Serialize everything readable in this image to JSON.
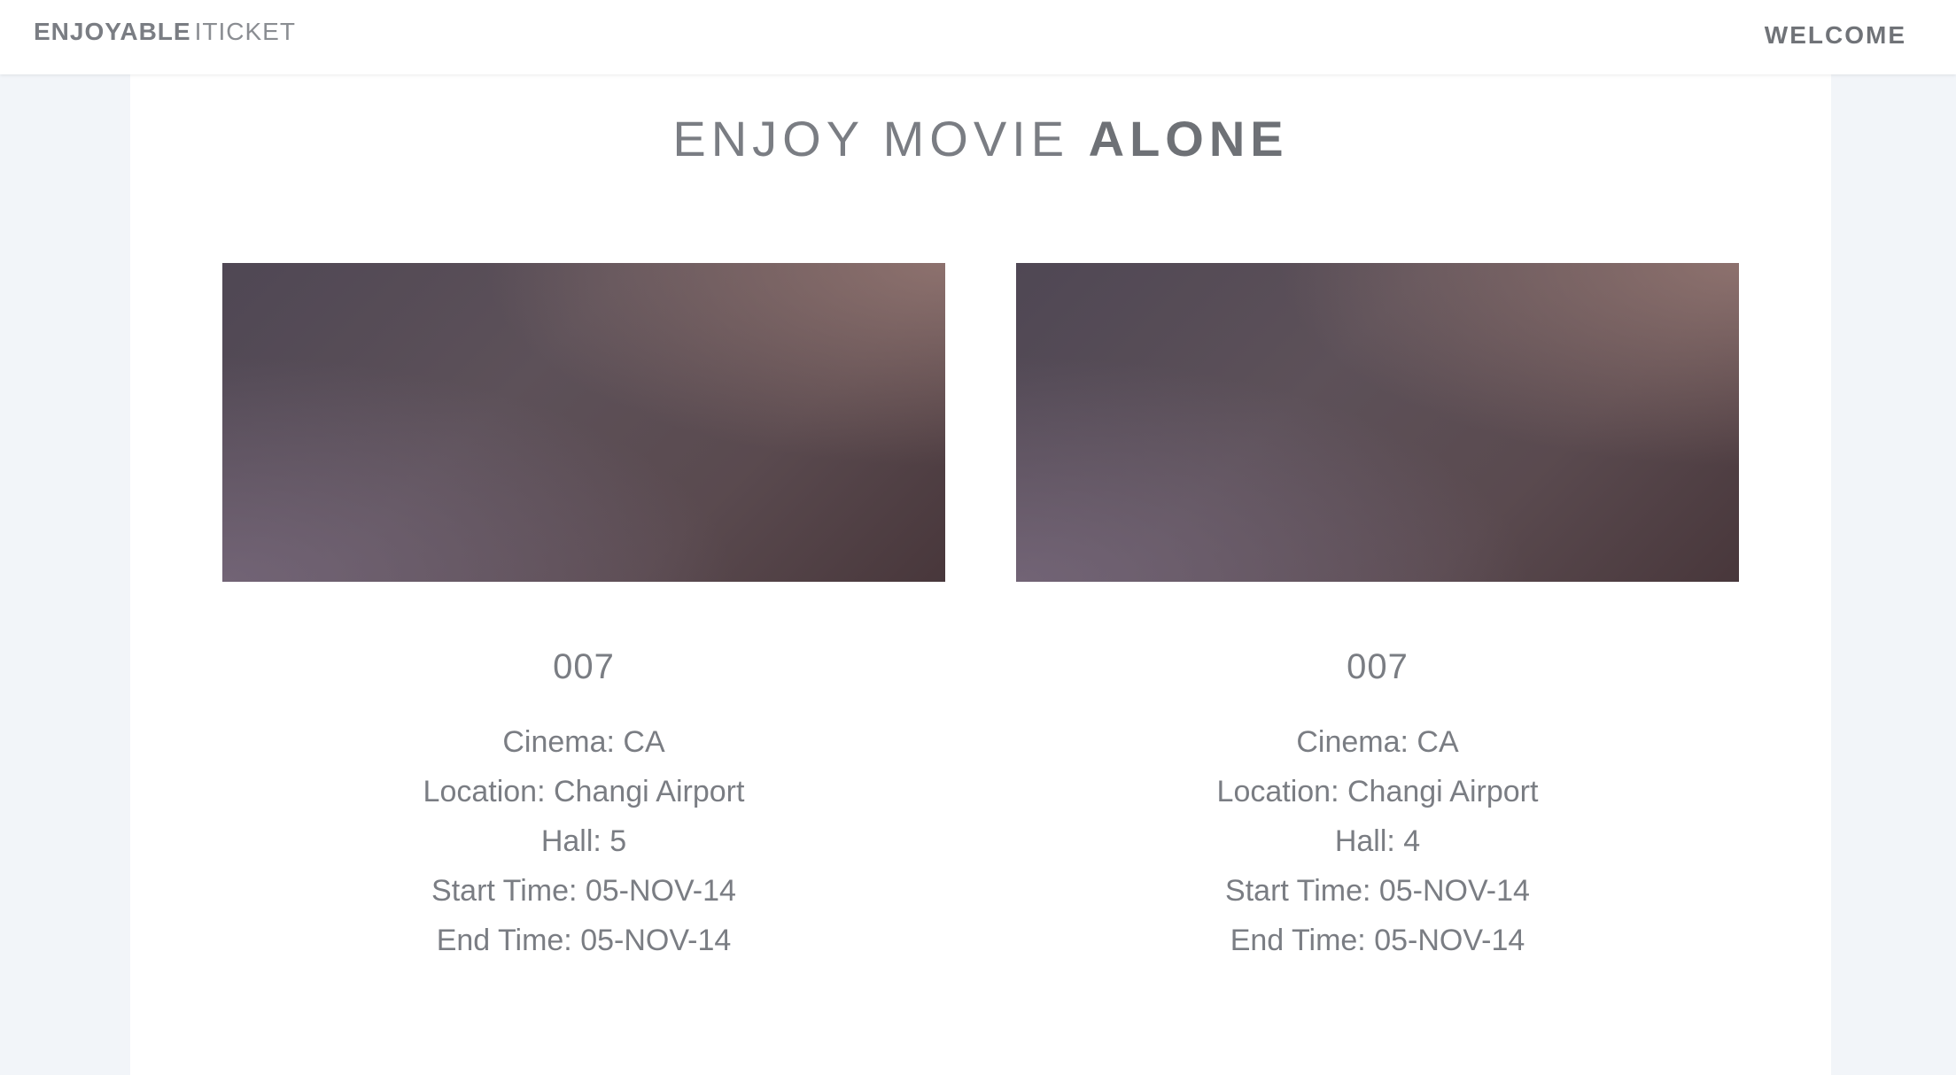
{
  "navbar": {
    "brand_bold": "ENJOYABLE",
    "brand_light": "ITICKET",
    "welcome": "WELCOME"
  },
  "page": {
    "title_light": "ENJOY MOVIE ",
    "title_bold": "ALONE"
  },
  "tickets": [
    {
      "movie": "007",
      "cinema": "Cinema: CA",
      "location": "Location: Changi Airport",
      "hall": "Hall: 5",
      "start": "Start Time: 05-NOV-14",
      "end": "End Time: 05-NOV-14"
    },
    {
      "movie": "007",
      "cinema": "Cinema: CA",
      "location": "Location: Changi Airport",
      "hall": "Hall: 4",
      "start": "Start Time: 05-NOV-14",
      "end": "End Time: 05-NOV-14"
    }
  ]
}
